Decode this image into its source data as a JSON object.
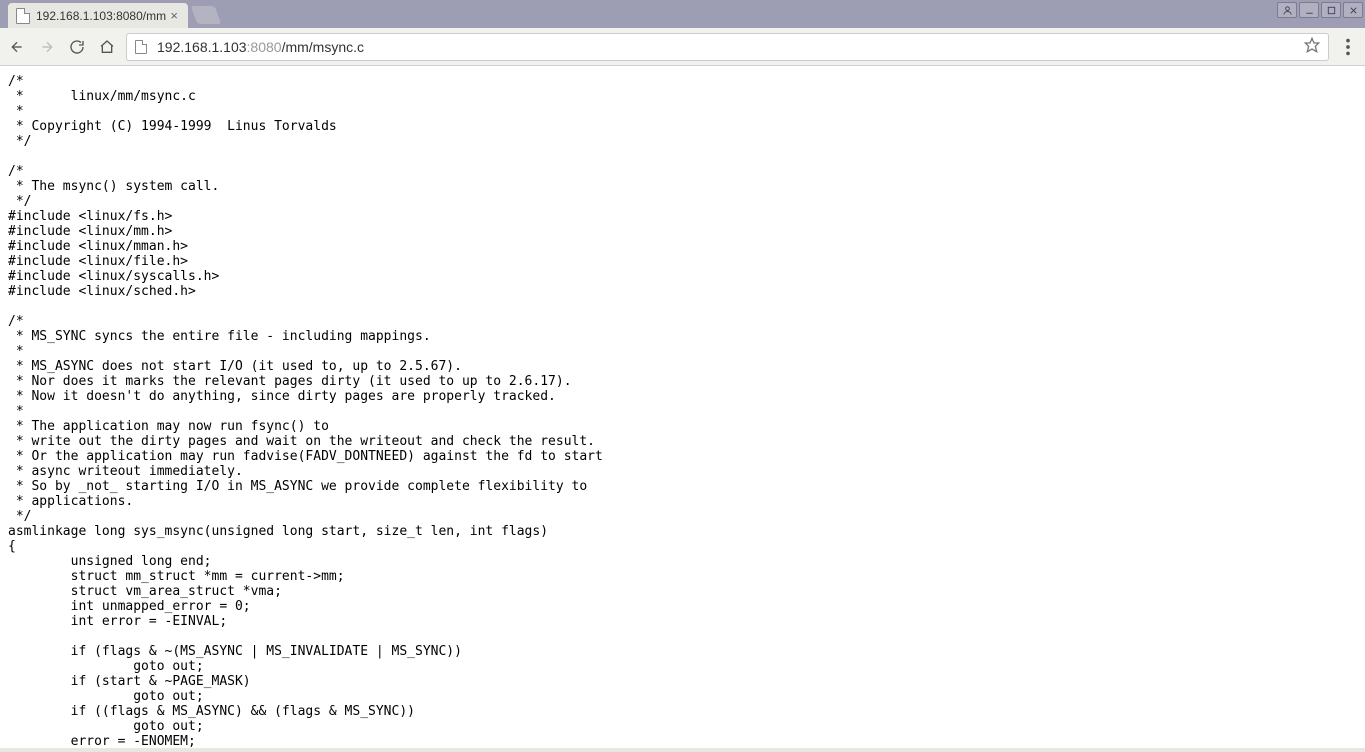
{
  "tab": {
    "title": "192.168.1.103:8080/mm"
  },
  "url": {
    "host": "192.168.1.103",
    "port": ":8080",
    "path": "/mm/msync.c"
  },
  "source": "/*\n *      linux/mm/msync.c\n *\n * Copyright (C) 1994-1999  Linus Torvalds\n */\n\n/*\n * The msync() system call.\n */\n#include <linux/fs.h>\n#include <linux/mm.h>\n#include <linux/mman.h>\n#include <linux/file.h>\n#include <linux/syscalls.h>\n#include <linux/sched.h>\n\n/*\n * MS_SYNC syncs the entire file - including mappings.\n *\n * MS_ASYNC does not start I/O (it used to, up to 2.5.67).\n * Nor does it marks the relevant pages dirty (it used to up to 2.6.17).\n * Now it doesn't do anything, since dirty pages are properly tracked.\n *\n * The application may now run fsync() to\n * write out the dirty pages and wait on the writeout and check the result.\n * Or the application may run fadvise(FADV_DONTNEED) against the fd to start\n * async writeout immediately.\n * So by _not_ starting I/O in MS_ASYNC we provide complete flexibility to\n * applications.\n */\nasmlinkage long sys_msync(unsigned long start, size_t len, int flags)\n{\n        unsigned long end;\n        struct mm_struct *mm = current->mm;\n        struct vm_area_struct *vma;\n        int unmapped_error = 0;\n        int error = -EINVAL;\n\n        if (flags & ~(MS_ASYNC | MS_INVALIDATE | MS_SYNC))\n                goto out;\n        if (start & ~PAGE_MASK)\n                goto out;\n        if ((flags & MS_ASYNC) && (flags & MS_SYNC))\n                goto out;\n        error = -ENOMEM;\n"
}
